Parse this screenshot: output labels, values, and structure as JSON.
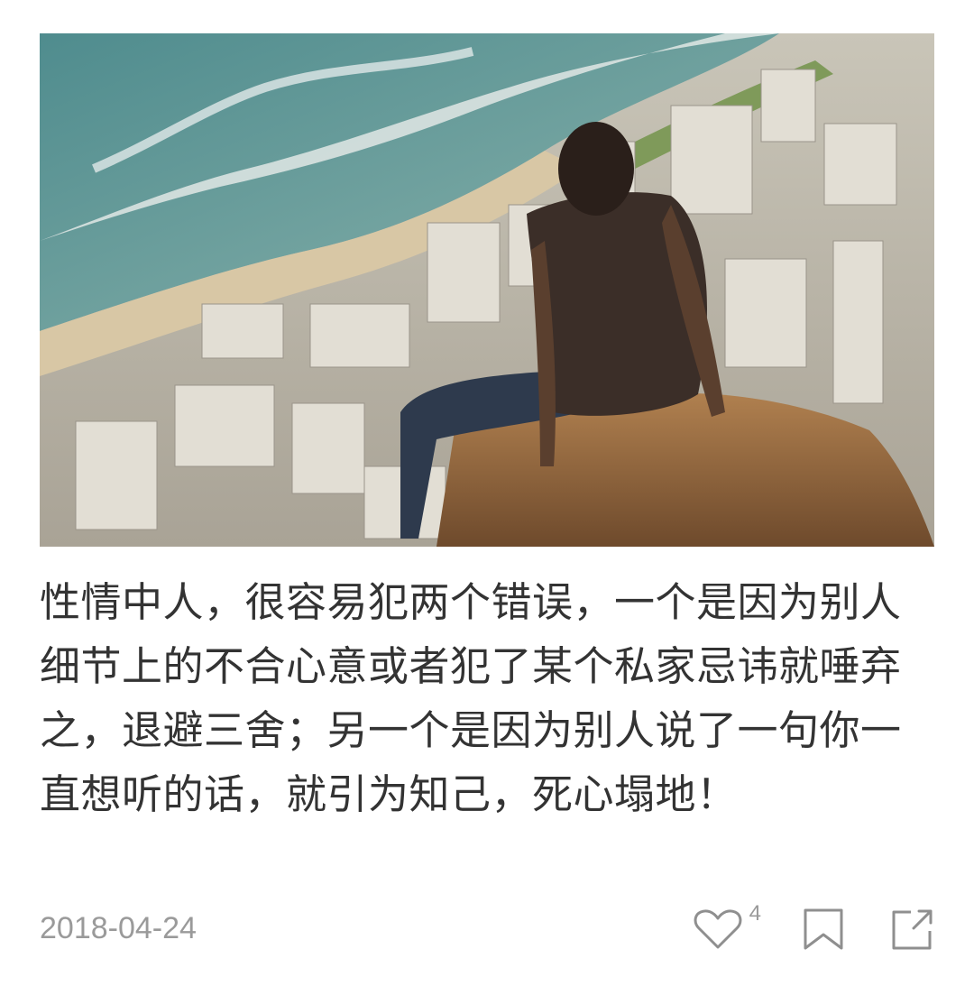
{
  "photo": {
    "icon": "photo-man-sitting-on-cliff-overlooking-city"
  },
  "post": {
    "text": "性情中人，很容易犯两个错误，一个是因为别人细节上的不合心意或者犯了某个私家忌讳就唾弃之，退避三舍；另一个是因为别人说了一句你一直想听的话，就引为知己，死心塌地！"
  },
  "footer": {
    "date": "2018-04-24",
    "like_count": "4",
    "like_icon": "heart-outline-icon",
    "bookmark_icon": "bookmark-outline-icon",
    "share_icon": "share-external-icon"
  },
  "colors": {
    "text": "#333333",
    "meta": "#9a9a9a",
    "icon": "#8f8f8f"
  }
}
